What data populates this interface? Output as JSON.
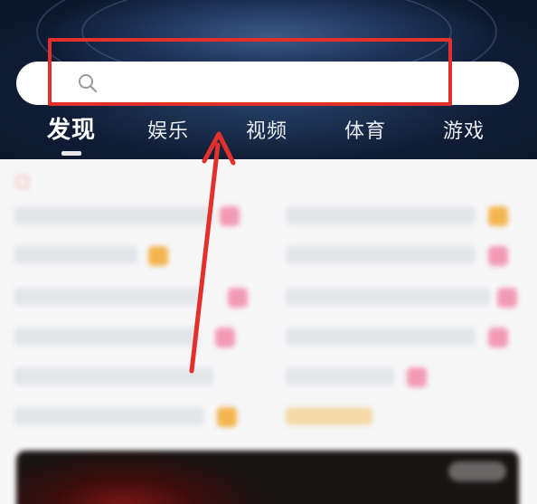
{
  "search": {
    "placeholder": "",
    "icon": "search-icon"
  },
  "tabs": [
    {
      "label": "发现",
      "active": true
    },
    {
      "label": "娱乐",
      "active": false
    },
    {
      "label": "视频",
      "active": false
    },
    {
      "label": "体育",
      "active": false
    },
    {
      "label": "游戏",
      "active": false
    }
  ],
  "colors": {
    "header_bg": "#0f1c34",
    "annotation_red": "#e3302c",
    "badge_pink": "#f29ab6",
    "badge_orange": "#f3b54f"
  }
}
